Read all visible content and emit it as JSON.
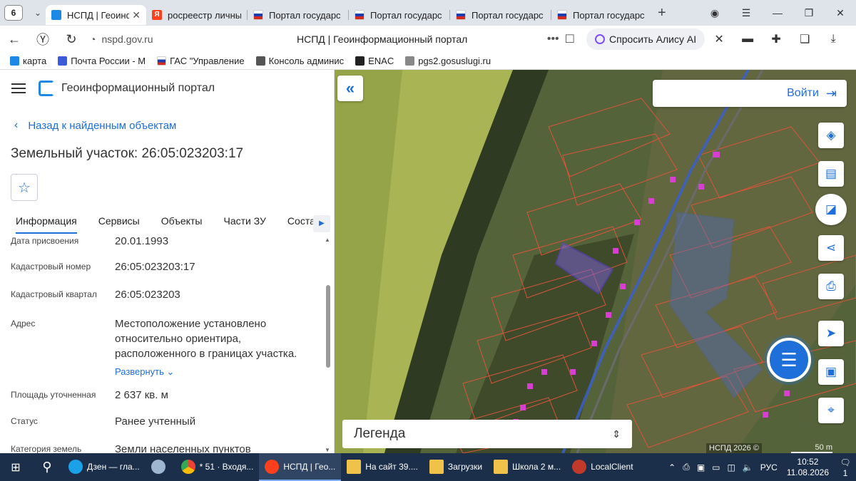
{
  "browser": {
    "tab_count": "6",
    "tabs": [
      {
        "title": "НСПД | Геоинф",
        "active": true,
        "icon": "nspd"
      },
      {
        "title": "росреестр личны",
        "active": false,
        "icon": "ya"
      },
      {
        "title": "Портал государс",
        "active": false,
        "icon": "flag"
      },
      {
        "title": "Портал государс",
        "active": false,
        "icon": "flag"
      },
      {
        "title": "Портал государс",
        "active": false,
        "icon": "flag"
      },
      {
        "title": "Портал государс",
        "active": false,
        "icon": "flag"
      }
    ],
    "new_tab": "+",
    "host": "nspd.gov.ru",
    "page_title": "НСПД | Геоинформационный портал",
    "alice": "Спросить Алису AI",
    "bookmarks": [
      {
        "label": "карта",
        "color": "#1e88e5"
      },
      {
        "label": "Почта России - М",
        "color": "#3b5bdb"
      },
      {
        "label": "ГАС \"Управление",
        "color": "#d52b1e"
      },
      {
        "label": "Консоль админис",
        "color": "#555555"
      },
      {
        "label": "ENAC",
        "color": "#222222"
      },
      {
        "label": "pgs2.gosuslugi.ru",
        "color": "#888888"
      }
    ]
  },
  "panel": {
    "portal_name": "Геоинформационный портал",
    "back_label": "Назад к найденным объектам",
    "object_title": "Земельный участок: 26:05:023203:17",
    "tabs": [
      "Информация",
      "Сервисы",
      "Объекты",
      "Части ЗУ",
      "Состав"
    ],
    "rows": [
      {
        "k": "Дата присвоения",
        "v": "20.01.1993"
      },
      {
        "k": "Кадастровый номер",
        "v": "26:05:023203:17"
      },
      {
        "k": "Кадастровый квартал",
        "v": "26:05:023203"
      },
      {
        "k": "Адрес",
        "v": "Местоположение установлено относительно ориентира, расположенного в границах участка."
      },
      {
        "k": "Площадь уточненная",
        "v": "2 637 кв. м"
      },
      {
        "k": "Статус",
        "v": "Ранее учтенный"
      },
      {
        "k": "Категория земель",
        "v": "Земли населенных пунктов"
      }
    ],
    "expand_label": "Развернуть"
  },
  "map": {
    "login_label": "Войти",
    "legend_label": "Легенда",
    "credit": "НСПД 2026 ©",
    "scale": "50 m"
  },
  "taskbar": {
    "apps": [
      {
        "label": "Дзен — гла...",
        "color": "#1aa1e8",
        "on": false
      },
      {
        "label": "",
        "color": "#9fb6d0",
        "on": false
      },
      {
        "label": "* 51 · Входя...",
        "color": "#f2b632",
        "on": false
      },
      {
        "label": "НСПД | Гео...",
        "color": "#fc3f1d",
        "on": true
      },
      {
        "label": "На сайт 39....",
        "color": "#f0c24a",
        "on": false
      },
      {
        "label": "Загрузки",
        "color": "#f0c24a",
        "on": false
      },
      {
        "label": "Школа 2 м...",
        "color": "#f0c24a",
        "on": false
      },
      {
        "label": "LocalClient",
        "color": "#c0392b",
        "on": false
      }
    ],
    "lang": "РУС",
    "time": "10:52",
    "date": "11.08.2026",
    "notifications": "1"
  }
}
